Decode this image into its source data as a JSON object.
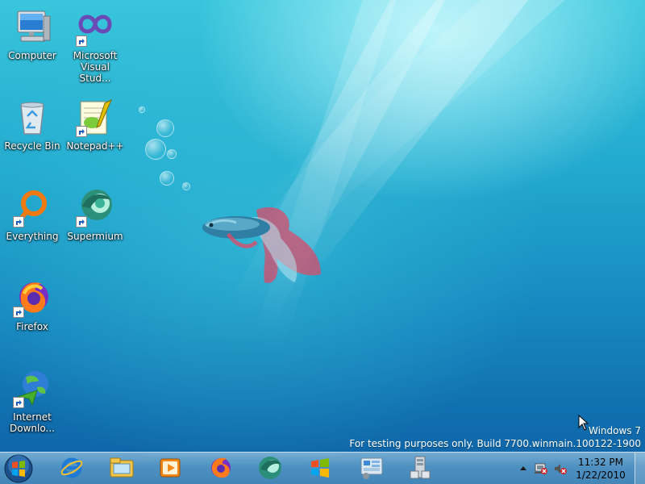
{
  "desktop": {
    "icons": [
      {
        "label": "Computer",
        "icon": "computer-icon",
        "shortcut": false
      },
      {
        "label": "Microsoft Visual Stud...",
        "icon": "visual-studio-icon",
        "shortcut": true
      },
      {
        "label": "Recycle Bin",
        "icon": "recycle-bin-icon",
        "shortcut": false
      },
      {
        "label": "Notepad++",
        "icon": "notepad-plus-plus-icon",
        "shortcut": true
      },
      {
        "label": "Everything",
        "icon": "everything-search-icon",
        "shortcut": true
      },
      {
        "label": "Supermium",
        "icon": "supermium-icon",
        "shortcut": true
      },
      {
        "label": "Firefox",
        "icon": "firefox-icon",
        "shortcut": true
      },
      {
        "label": "Internet Downlo...",
        "icon": "internet-download-manager-icon",
        "shortcut": true
      }
    ]
  },
  "watermark": {
    "line1": "Windows 7",
    "line2": "For testing purposes only. Build 7700.winmain.100122-1900"
  },
  "taskbar": {
    "start_icon": "windows-start-orb-icon",
    "pinned": [
      "internet-explorer-icon",
      "windows-explorer-icon",
      "media-player-icon",
      "firefox-icon",
      "supermium-icon",
      "windows-flag-icon",
      "control-panel-icon",
      "device-manager-icon"
    ],
    "tray": {
      "icons": [
        "show-hidden-icons-chevron-icon",
        "network-icon",
        "volume-muted-icon"
      ],
      "time": "11:32 PM",
      "date": "1/22/2010"
    }
  },
  "colors": {
    "wallpaper_top": "#39c6dc",
    "wallpaper_bottom": "#0d5ea3"
  }
}
